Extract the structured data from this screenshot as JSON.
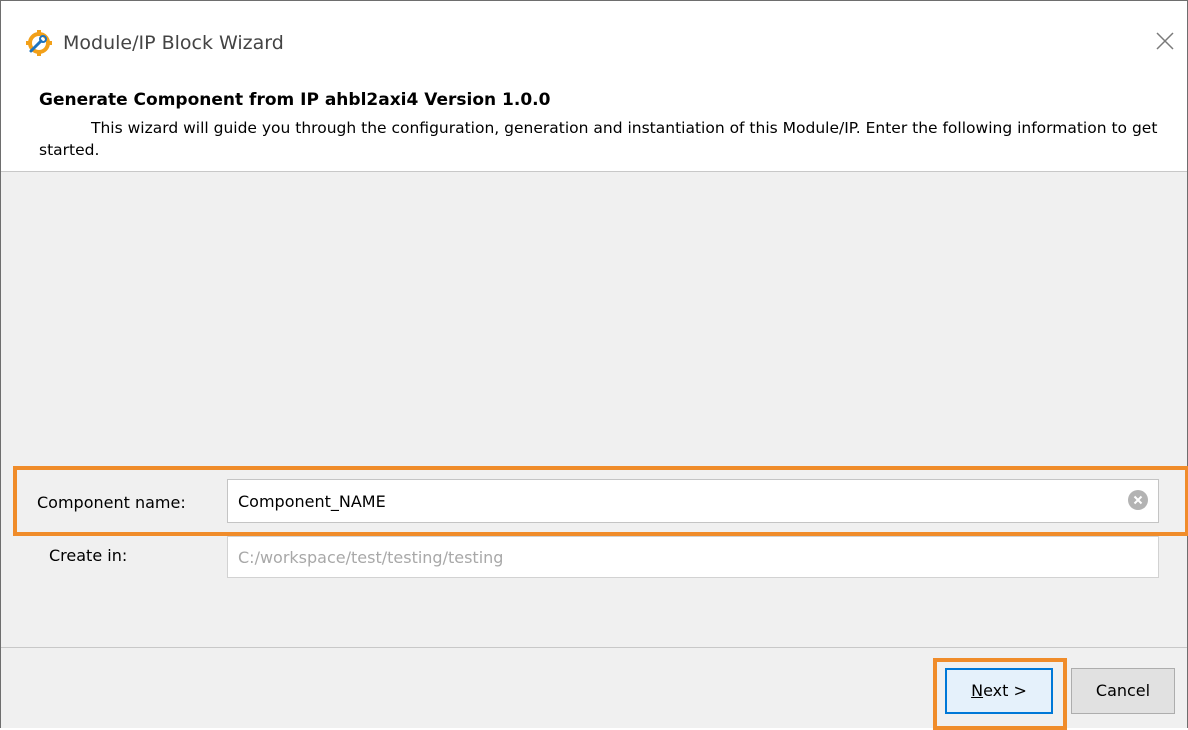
{
  "window": {
    "title": "Module/IP Block Wizard"
  },
  "header": {
    "title": "Generate Component from IP ahbl2axi4 Version 1.0.0",
    "description": "This wizard will guide you through the configuration, generation and instantiation of this Module/IP. Enter the following information to get started."
  },
  "form": {
    "component_name_label": "Component name:",
    "component_name_value": "Component_NAME",
    "create_in_label": "Create in:",
    "create_in_value": "C:/workspace/test/testing/testing"
  },
  "footer": {
    "next_mnemonic": "N",
    "next_rest": "ext >",
    "cancel_label": "Cancel"
  },
  "colors": {
    "highlight": "#f08c2a",
    "app_icon": "#f2a019",
    "app_icon_accent": "#1e73be"
  },
  "icons": {
    "app": "wrench-gear-icon",
    "close": "close-icon",
    "clear": "clear-circle-icon"
  }
}
